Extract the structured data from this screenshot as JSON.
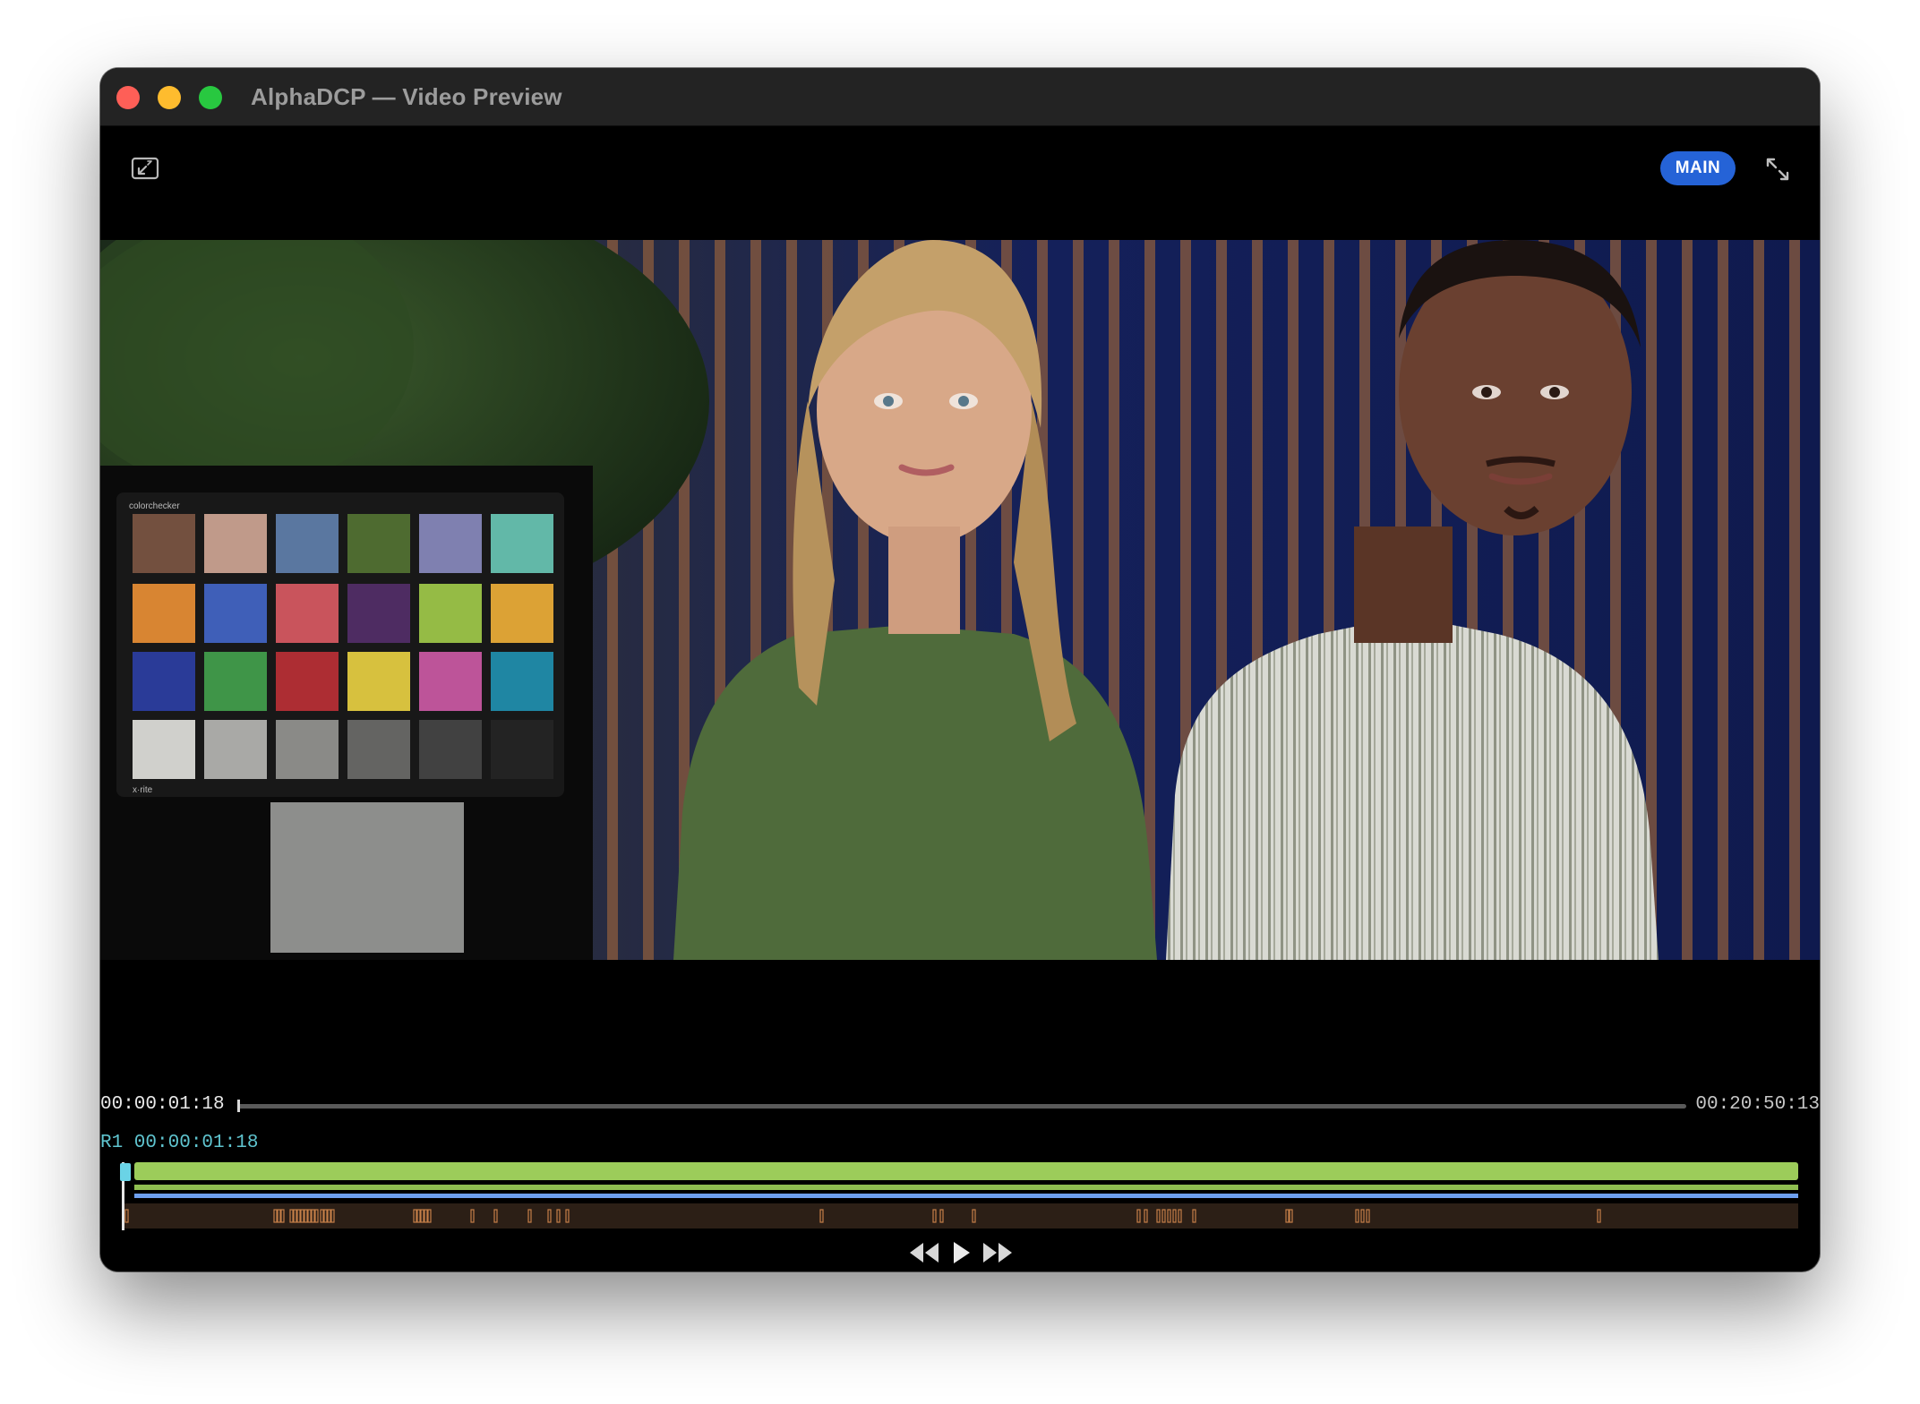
{
  "window": {
    "title": "AlphaDCP — Video Preview"
  },
  "toolbar": {
    "badge_label": "MAIN",
    "badge_color": "#2563d7",
    "left_icon": "picture-in-picture-exit-icon",
    "right_icon": "expand-arrows-icon"
  },
  "player": {
    "current_timecode": "00:00:01:18",
    "total_timecode": "00:20:50:13",
    "progress_fraction": 0.001,
    "reel_label": "R1 00:00:01:18",
    "transport_icons": [
      "rewind-icon",
      "play-icon",
      "fast-forward-icon"
    ]
  },
  "colorchecker": {
    "brand_text": "colorchecker",
    "maker_text": "x·rite"
  },
  "colors": {
    "timeline_green": "#9ccc5a",
    "timeline_blue": "#6ea0f0",
    "marker_orange": "#c57f48",
    "reel_label_color": "#5fc4cf"
  }
}
